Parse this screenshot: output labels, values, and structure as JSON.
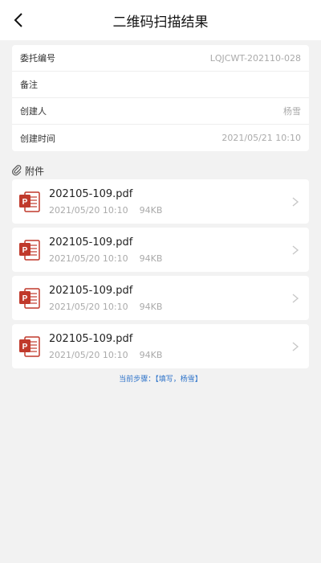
{
  "header": {
    "title": "二维码扫描结果"
  },
  "info": [
    {
      "label": "委托编号",
      "value": "LQJCWT-202110-028"
    },
    {
      "label": "备注",
      "value": ""
    },
    {
      "label": "创建人",
      "value": "杨雪"
    },
    {
      "label": "创建时间",
      "value": "2021/05/21  10:10"
    }
  ],
  "attachments": {
    "title": "附件",
    "files": [
      {
        "name": "202105-109.pdf",
        "date": "2021/05/20  10:10",
        "size": "94KB"
      },
      {
        "name": "202105-109.pdf",
        "date": "2021/05/20  10:10",
        "size": "94KB"
      },
      {
        "name": "202105-109.pdf",
        "date": "2021/05/20  10:10",
        "size": "94KB"
      },
      {
        "name": "202105-109.pdf",
        "date": "2021/05/20  10:10",
        "size": "94KB"
      }
    ]
  },
  "step": {
    "text": "当前步骤：【填写，杨雪】"
  },
  "icons": {
    "back": "chevron-left-icon",
    "attachment": "paperclip-icon",
    "file": "pdf-file-icon",
    "arrow": "chevron-right-icon"
  },
  "colors": {
    "pdf_red": "#c0392b",
    "link_blue": "#2d73c9"
  }
}
